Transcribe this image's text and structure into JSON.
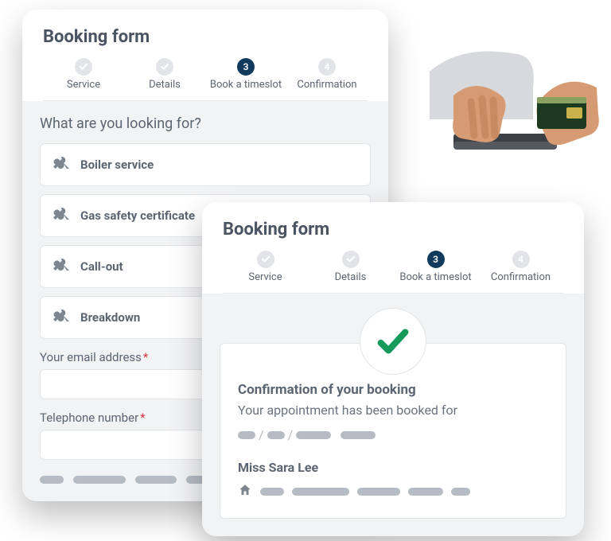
{
  "card1": {
    "title": "Booking form",
    "steps": [
      {
        "label": "Service",
        "num": ""
      },
      {
        "label": "Details",
        "num": ""
      },
      {
        "label": "Book a timeslot",
        "num": "3"
      },
      {
        "label": "Confirmation",
        "num": "4"
      }
    ],
    "prompt": "What are you looking for?",
    "choices": [
      {
        "label": "Boiler service"
      },
      {
        "label": "Gas safety certificate"
      },
      {
        "label": "Call-out"
      },
      {
        "label": "Breakdown"
      }
    ],
    "email_label": "Your email address",
    "phone_label": "Telephone number",
    "required_mark": "*"
  },
  "card2": {
    "title": "Booking form",
    "steps": [
      {
        "label": "Service",
        "num": ""
      },
      {
        "label": "Details",
        "num": ""
      },
      {
        "label": "Book a timeslot",
        "num": "3"
      },
      {
        "label": "Confirmation",
        "num": "4"
      }
    ],
    "confirm_title": "Confirmation of your booking",
    "confirm_sub": "Your appointment has been booked for",
    "customer_name": "Miss Sara Lee"
  }
}
